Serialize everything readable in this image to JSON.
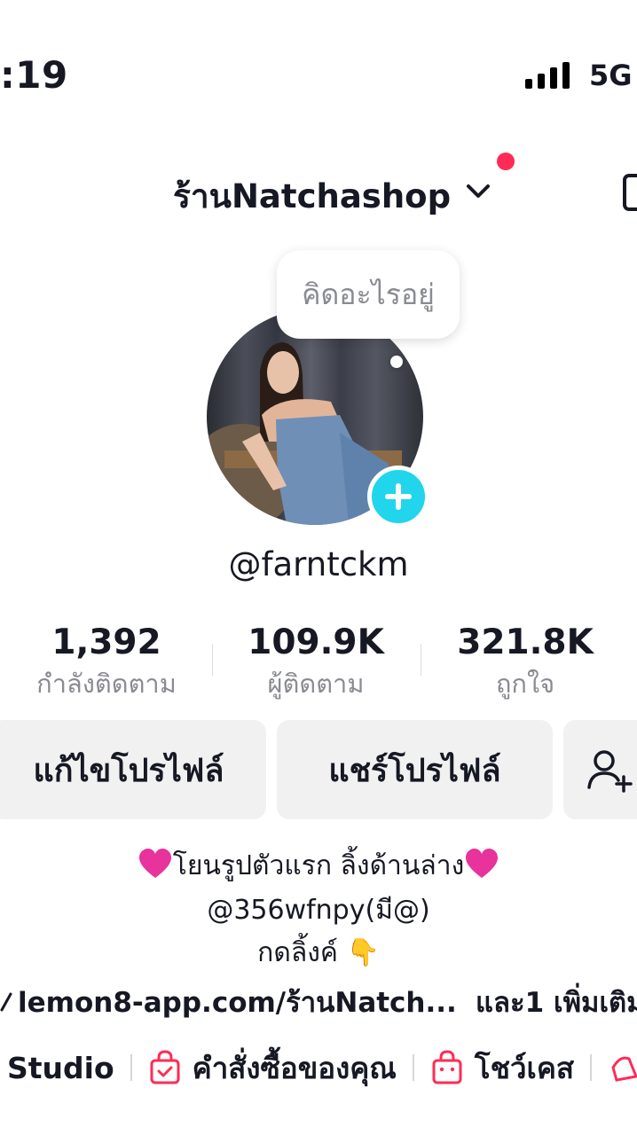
{
  "status_bar": {
    "time": ":19",
    "network": "5G"
  },
  "header": {
    "username_title": "ร้านNatchashop"
  },
  "avatar": {
    "bubble_text": "คิดอะไรอยู่"
  },
  "profile": {
    "handle": "@farntckm"
  },
  "stats": [
    {
      "value": "1,392",
      "label": "กำลังติดตาม"
    },
    {
      "value": "109.9K",
      "label": "ผู้ติดตาม"
    },
    {
      "value": "321.8K",
      "label": "ถูกใจ"
    }
  ],
  "buttons": {
    "edit_profile": "แก้ไขโปรไฟล์",
    "share_profile": "แชร์โปรไฟล์"
  },
  "bio": {
    "line1": "โยนรูปตัวแรก ลิ้งด้านล่าง",
    "line2": "@356wfnpy(มี@)",
    "line3": "กดลิ้งค์ 👇"
  },
  "link": {
    "url": "lemon8-app.com/ร้านNatch...",
    "more": "และ1 เพิ่มเติม"
  },
  "tools": {
    "studio": "Studio",
    "orders": "คำสั่งซื้อของคุณ",
    "showcase": "โชว์เคส"
  },
  "colors": {
    "accent_red": "#fe2c55",
    "plus_cyan": "#20d5ec",
    "heart_pink": "#e7339b"
  }
}
